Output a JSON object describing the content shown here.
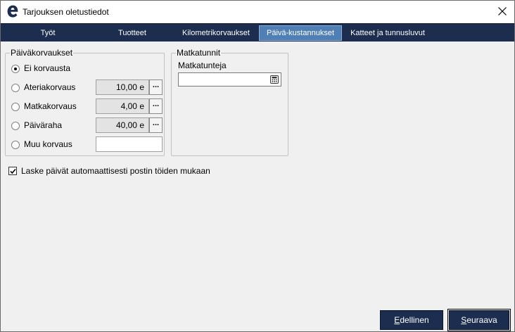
{
  "window": {
    "title": "Tarjouksen oletustiedot"
  },
  "tabs": [
    {
      "label": "Työt",
      "active": false
    },
    {
      "label": "Tuotteet",
      "active": false
    },
    {
      "label": "Kilometrikorvaukset",
      "active": false
    },
    {
      "label": "Päivä-kustannukset",
      "active": true
    },
    {
      "label": "Katteet ja tunnusluvut",
      "active": false
    }
  ],
  "paivakorvaukset": {
    "legend": "Päiväkorvaukset",
    "options": [
      {
        "label": "Ei korvausta",
        "checked": true,
        "value": null
      },
      {
        "label": "Ateriakorvaus",
        "checked": false,
        "value": "10,00 e"
      },
      {
        "label": "Matkakorvaus",
        "checked": false,
        "value": "4,00 e"
      },
      {
        "label": "Päiväraha",
        "checked": false,
        "value": "40,00 e"
      },
      {
        "label": "Muu korvaus",
        "checked": false,
        "value": ""
      }
    ],
    "more_button_label": "..."
  },
  "matkatunnit": {
    "legend": "Matkatunnit",
    "field_label": "Matkatunteja",
    "field_value": ""
  },
  "auto_days": {
    "label": "Laske päivät automaattisesti postin töiden mukaan",
    "checked": true
  },
  "footer": {
    "prev_label_first": "E",
    "prev_label_rest": "dellinen",
    "next_label_first": "S",
    "next_label_rest": "euraava"
  },
  "colors": {
    "tabbar_bg": "#1c2d4f",
    "tab_active_bg": "#4f7fb5",
    "button_bg": "#1c2d4f",
    "logo": "#1c2d4f"
  },
  "icons": {
    "app": "app-logo-e-icon",
    "close": "close-icon",
    "calculator": "calculator-icon",
    "more": "ellipsis-icon",
    "check": "checkmark-icon"
  }
}
